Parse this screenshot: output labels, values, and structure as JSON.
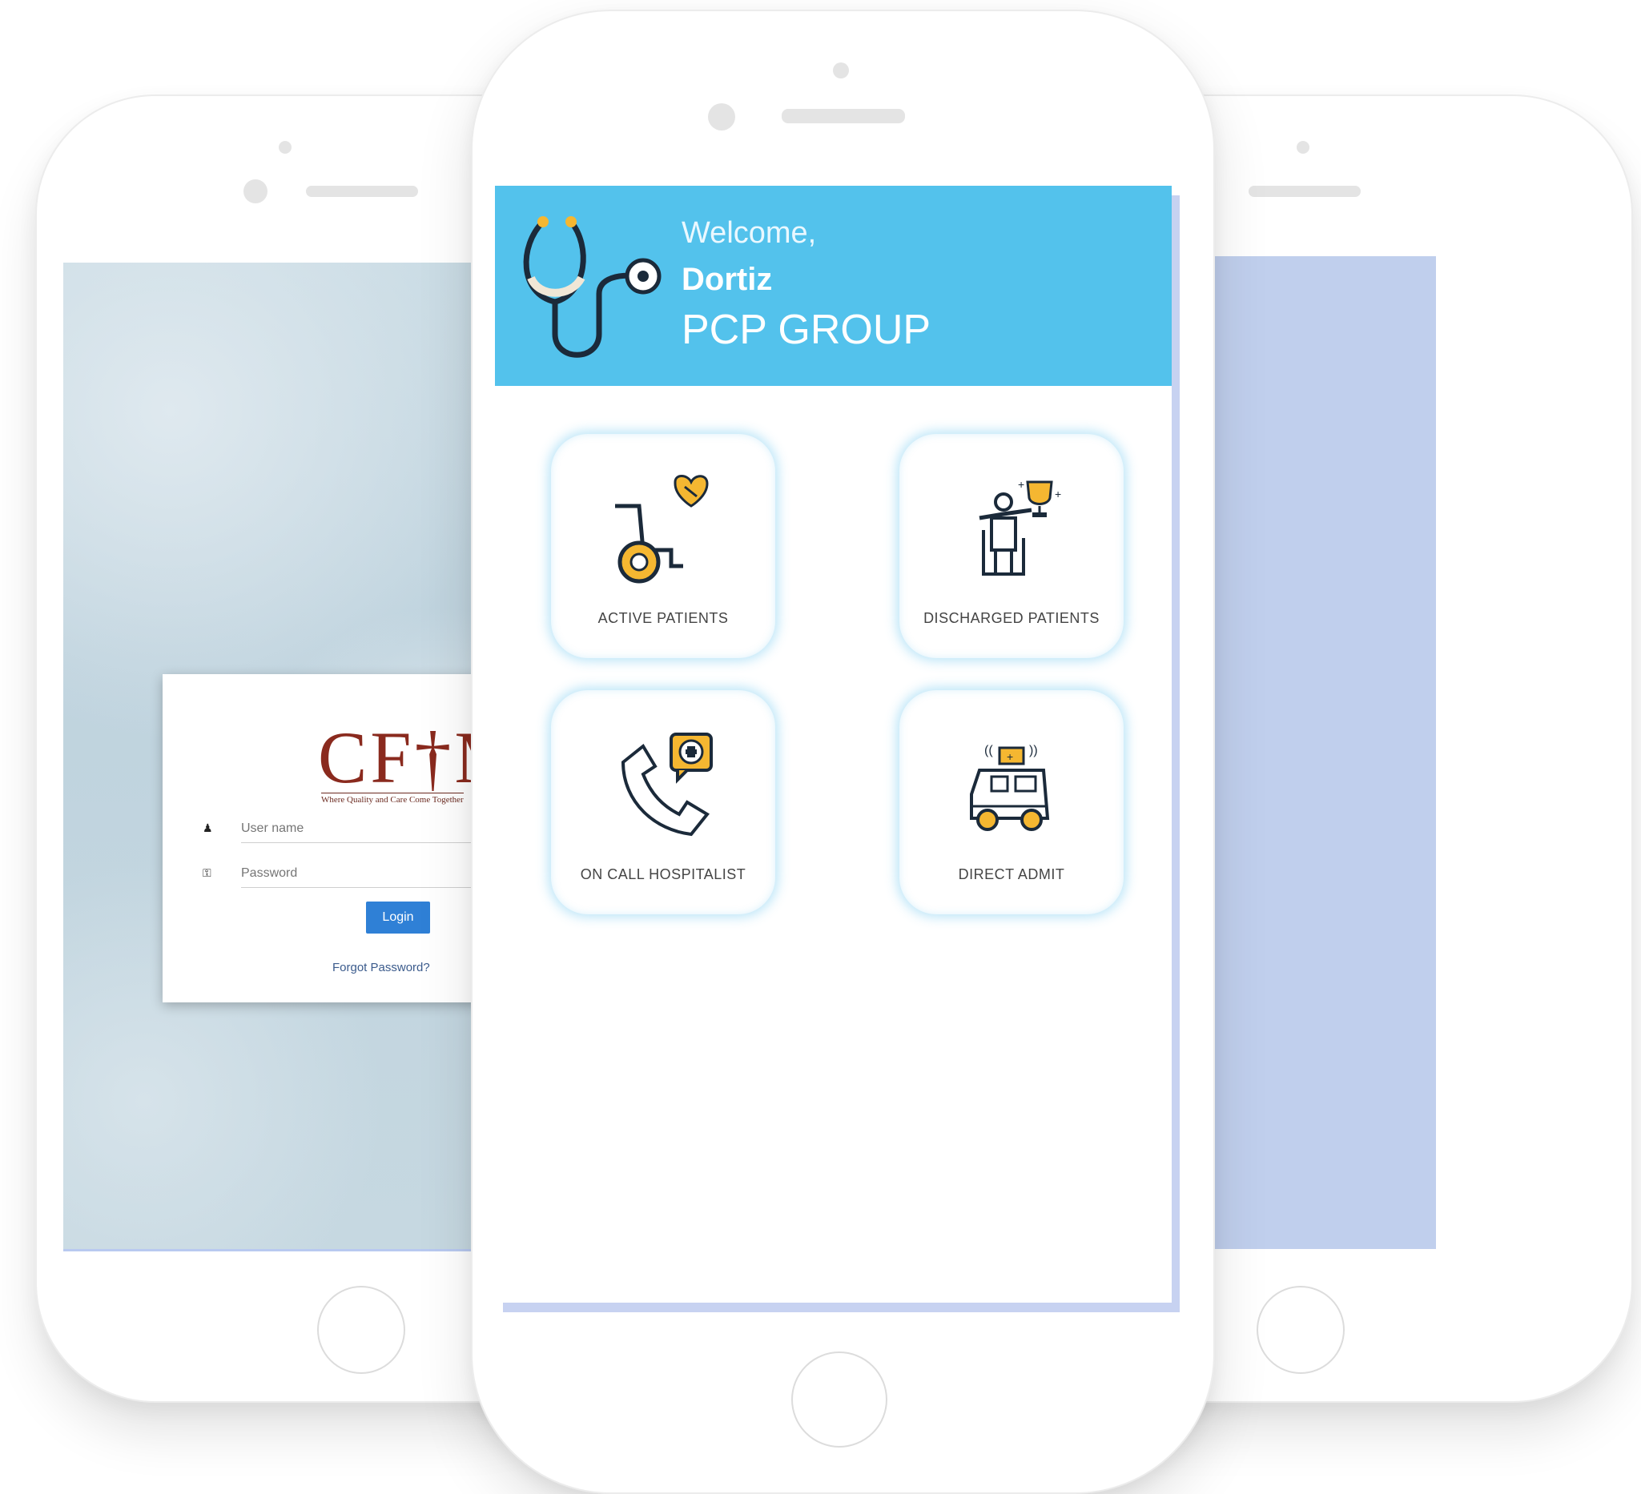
{
  "login": {
    "logo": "CF†M",
    "tagline": "Where Quality and Care Come Together",
    "username_placeholder": "User name",
    "password_placeholder": "Password",
    "login_label": "Login",
    "forgot_label": "Forgot Password?"
  },
  "dashboard": {
    "welcome": "Welcome,",
    "user": "Dortiz",
    "group": "PCP GROUP",
    "tiles": [
      {
        "label": "ACTIVE PATIENTS",
        "icon": "wheelchair-heart-icon"
      },
      {
        "label": "DISCHARGED PATIENTS",
        "icon": "patient-trophy-icon"
      },
      {
        "label": "ON CALL HOSPITALIST",
        "icon": "phone-medical-icon"
      },
      {
        "label": "DIRECT ADMIT",
        "icon": "ambulance-icon"
      }
    ]
  },
  "colors": {
    "header": "#53c2ec",
    "accent": "#f5b731",
    "login_button": "#2f80d6",
    "logo": "#8a2a1e",
    "right_screen": "#c0cfed"
  }
}
